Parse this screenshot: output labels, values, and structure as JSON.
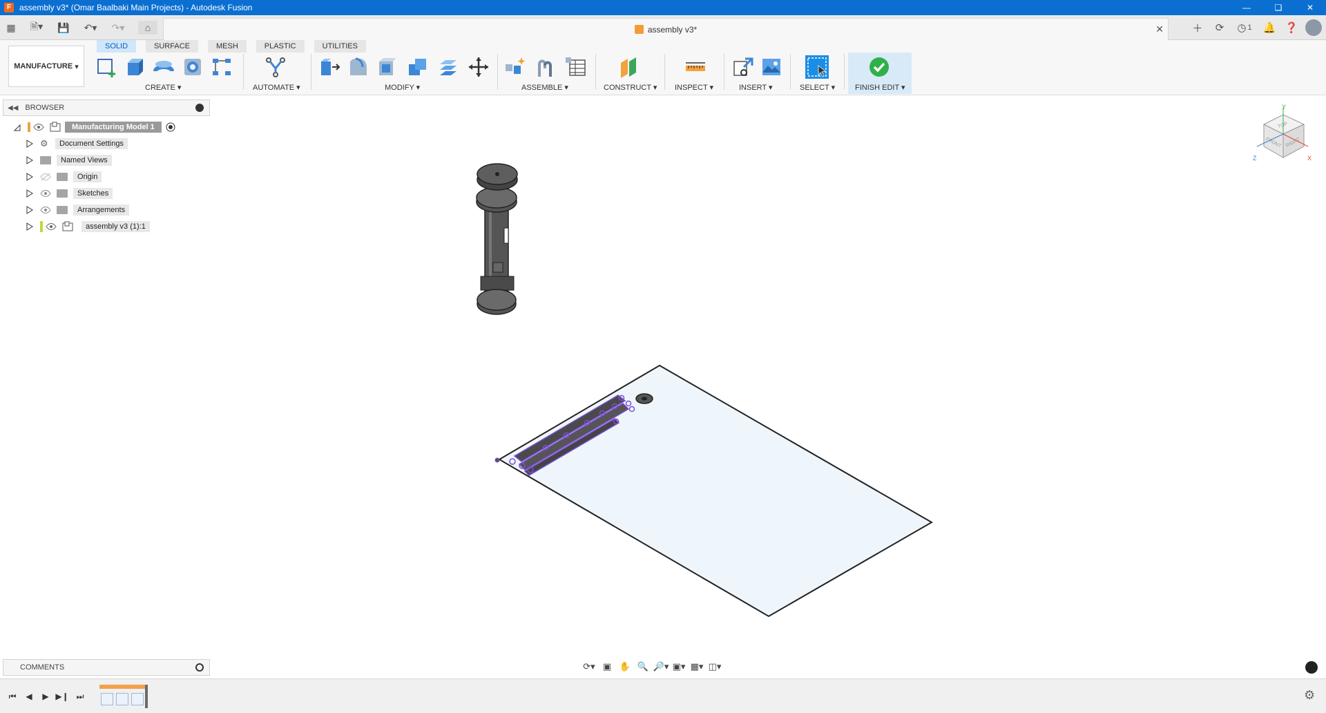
{
  "window": {
    "title": "assembly v3* (Omar Baalbaki Main Projects) - Autodesk Fusion",
    "app_icon": "F"
  },
  "document_tab": {
    "label": "assembly v3*"
  },
  "notifications": {
    "job_count": "1"
  },
  "workspace": {
    "label": "MANUFACTURE"
  },
  "ribbon_tabs": [
    {
      "label": "SOLID",
      "active": true
    },
    {
      "label": "SURFACE",
      "active": false
    },
    {
      "label": "MESH",
      "active": false
    },
    {
      "label": "PLASTIC",
      "active": false
    },
    {
      "label": "UTILITIES",
      "active": false
    }
  ],
  "ribbon_groups": {
    "create": "CREATE",
    "automate": "AUTOMATE",
    "modify": "MODIFY",
    "assemble": "ASSEMBLE",
    "construct": "CONSTRUCT",
    "inspect": "INSPECT",
    "insert": "INSERT",
    "select": "SELECT",
    "finish_edit": "FINISH EDIT"
  },
  "browser": {
    "title": "BROWSER",
    "root": "Manufacturing Model 1",
    "items": [
      {
        "label": "Document Settings",
        "icon": "gear-icon"
      },
      {
        "label": "Named Views",
        "icon": "folder-icon"
      },
      {
        "label": "Origin",
        "icon": "folder-icon"
      },
      {
        "label": "Sketches",
        "icon": "folder-icon"
      },
      {
        "label": "Arrangements",
        "icon": "folder-icon"
      },
      {
        "label": "assembly v3 (1):1",
        "icon": "component-icon"
      }
    ]
  },
  "comments": {
    "title": "COMMENTS"
  },
  "viewcube": {
    "top": "TOP",
    "front": "FRONT",
    "right": "RIGHT",
    "x": "X",
    "y": "Y",
    "z": "Z"
  },
  "colors": {
    "title_bar": "#0a6fd1",
    "active_tab": "#cfe6fb",
    "finish_check": "#2fb14a",
    "selection": "#7a4fd0",
    "sheet": "#eef6fc"
  }
}
